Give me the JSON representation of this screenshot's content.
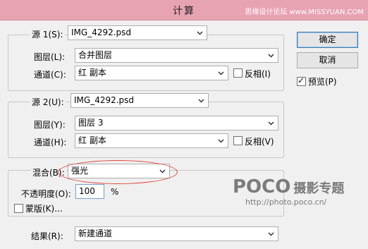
{
  "window": {
    "title": "计算",
    "watermark": "思缘设计论坛 www.MISSYUAN.COM"
  },
  "source1": {
    "label": "源 1(S):",
    "file": "IMG_4292.psd",
    "layer_label": "图层(L):",
    "layer_value": "合并图层",
    "channel_label": "通道(C):",
    "channel_value": "红 副本",
    "invert_label": "反相(I)",
    "invert_checked": false
  },
  "source2": {
    "label": "源 2(U):",
    "file": "IMG_4292.psd",
    "layer_label": "图层(Y):",
    "layer_value": "图层 3",
    "channel_label": "通道(H):",
    "channel_value": "红 副本",
    "invert_label": "反相(V)",
    "invert_checked": false
  },
  "blend": {
    "label": "混合(B):",
    "value": "强光",
    "opacity_label": "不透明度(O):",
    "opacity_value": "100",
    "opacity_unit": "%",
    "mask_label": "蒙版(K)...",
    "mask_checked": false
  },
  "result": {
    "label": "结果(R):",
    "value": "新建通道"
  },
  "buttons": {
    "ok": "确定",
    "cancel": "取消"
  },
  "preview": {
    "label": "预览(P)",
    "checked": true
  },
  "overlay": {
    "brand": "POCO",
    "brand_cn": "摄影专题",
    "url": "http://photo.poco.cn/"
  },
  "colors": {
    "titlebar": "#e8a3b3",
    "highlight_ellipse": "#e0443e"
  }
}
